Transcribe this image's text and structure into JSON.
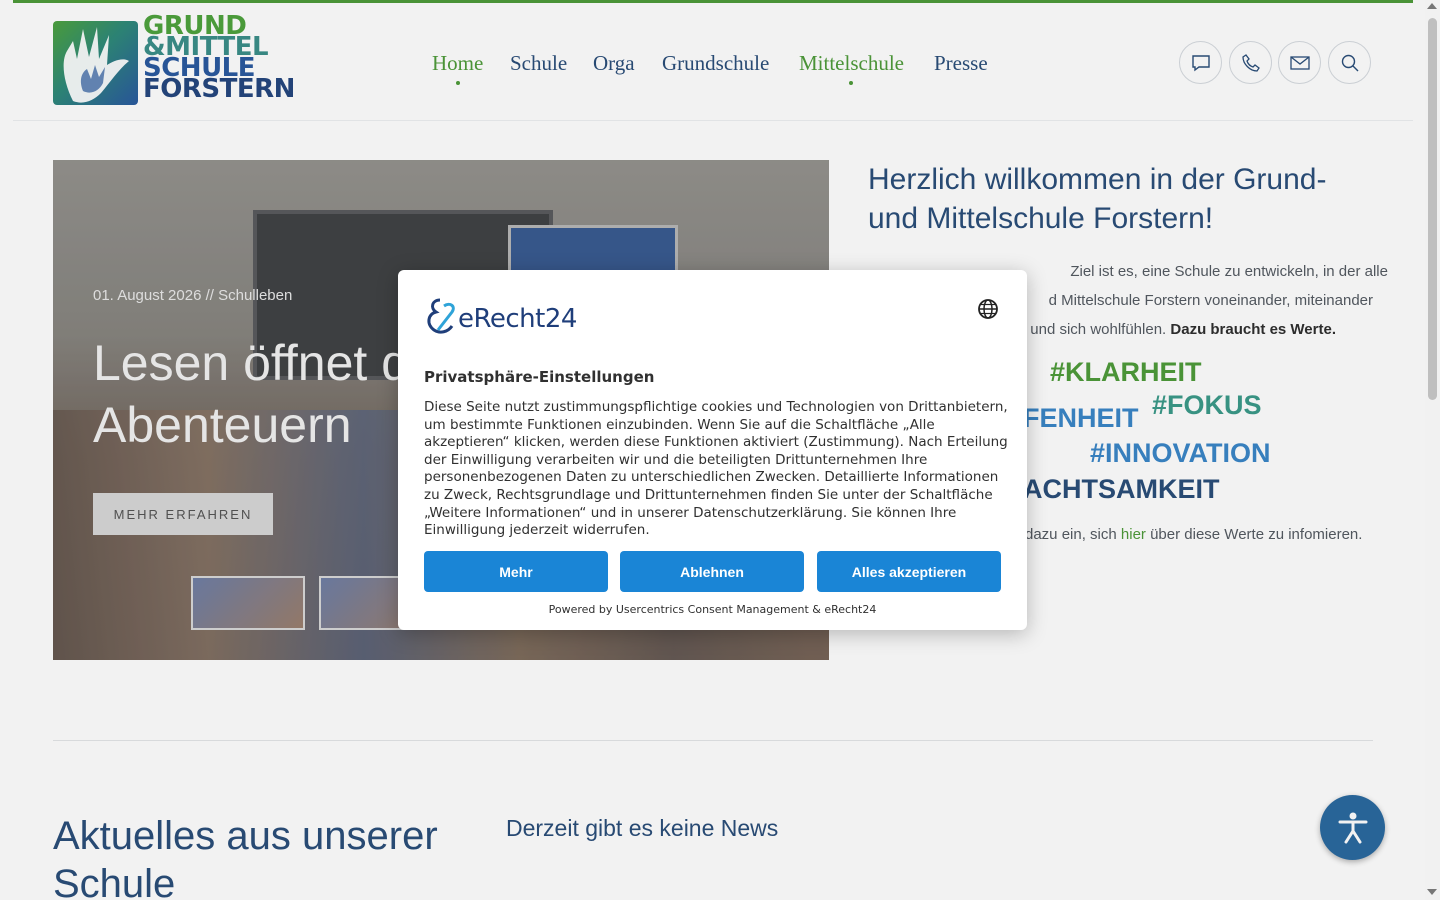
{
  "header": {
    "logo_lines": [
      "GRUND",
      "&MITTEL",
      "SCHULE",
      "FORSTERN"
    ],
    "nav": [
      {
        "label": "Home",
        "active": true
      },
      {
        "label": "Schule",
        "active": false
      },
      {
        "label": "Orga",
        "active": false
      },
      {
        "label": "Grundschule",
        "active": false
      },
      {
        "label": "Mittelschule",
        "active": true
      },
      {
        "label": "Presse",
        "active": false
      }
    ],
    "icons": [
      "chat-icon",
      "phone-icon",
      "mail-icon",
      "search-icon"
    ]
  },
  "slider": {
    "meta": "01. August 2026 // Schulleben",
    "title": "Lesen öffnet d\nAbenteuern",
    "button": "MEHR ERFAHREN"
  },
  "intro": {
    "heading": "Herzlich willkommen in der Grund- und Mittelschule Forstern!",
    "p1_line1": "Ziel ist es, eine Schule zu entwickeln, in der alle",
    "p1_line2": "d Mittelschule Forstern voneinander, miteinander",
    "p1_line3_a": "und sich wohlfühlen.",
    "p1_line3_b": "Dazu braucht es Werte.",
    "values": [
      {
        "text": "#KLARHEIT",
        "color": "#4f9b3a"
      },
      {
        "text": "FENHEIT",
        "color": "#3a86c8"
      },
      {
        "text": "#FOKUS",
        "color": "#3c9a8a"
      },
      {
        "text": "#INNOVATION",
        "color": "#3a86c8"
      },
      {
        "text": "ACHTSAMKEIT",
        "color": "#2b4e7a"
      }
    ],
    "p2_a": "dazu ein, sich",
    "p2_link": "hier",
    "p2_b": "über diese Werte zu infomieren."
  },
  "news": {
    "heading": "Aktuelles aus unserer Schule",
    "empty": "Derzeit gibt es keine News"
  },
  "consent": {
    "brand": "eRecht24",
    "title": "Privatsphäre-Einstellungen",
    "body": "Diese Seite nutzt zustimmungspflichtige cookies und Technologien von Drittanbietern, um bestimmte Funktionen einzubinden. Wenn Sie auf die Schaltfläche „Alle akzeptieren“ klicken, werden diese Funktionen aktiviert (Zustimmung). Nach Erteilung der Einwilligung verarbeiten wir und die beteiligten Drittunternehmen Ihre personenbezogenen Daten zu unterschiedlichen Zwecken. Detaillierte Informationen zu Zweck, Rechtsgrundlage und Drittunternehmen finden Sie unter der Schaltfläche „Weitere Informationen“ und in unserer Datenschutzerklärung. Sie können Ihre Einwilligung jederzeit widerrufen.",
    "btn_more": "Mehr",
    "btn_decline": "Ablehnen",
    "btn_accept": "Alles akzeptieren",
    "powered": "Powered by Usercentrics Consent Management & eRecht24"
  },
  "colors": {
    "primary_blue": "#2b4e7a",
    "accent_green": "#4f9b3a",
    "consent_button": "#1a85d6"
  }
}
